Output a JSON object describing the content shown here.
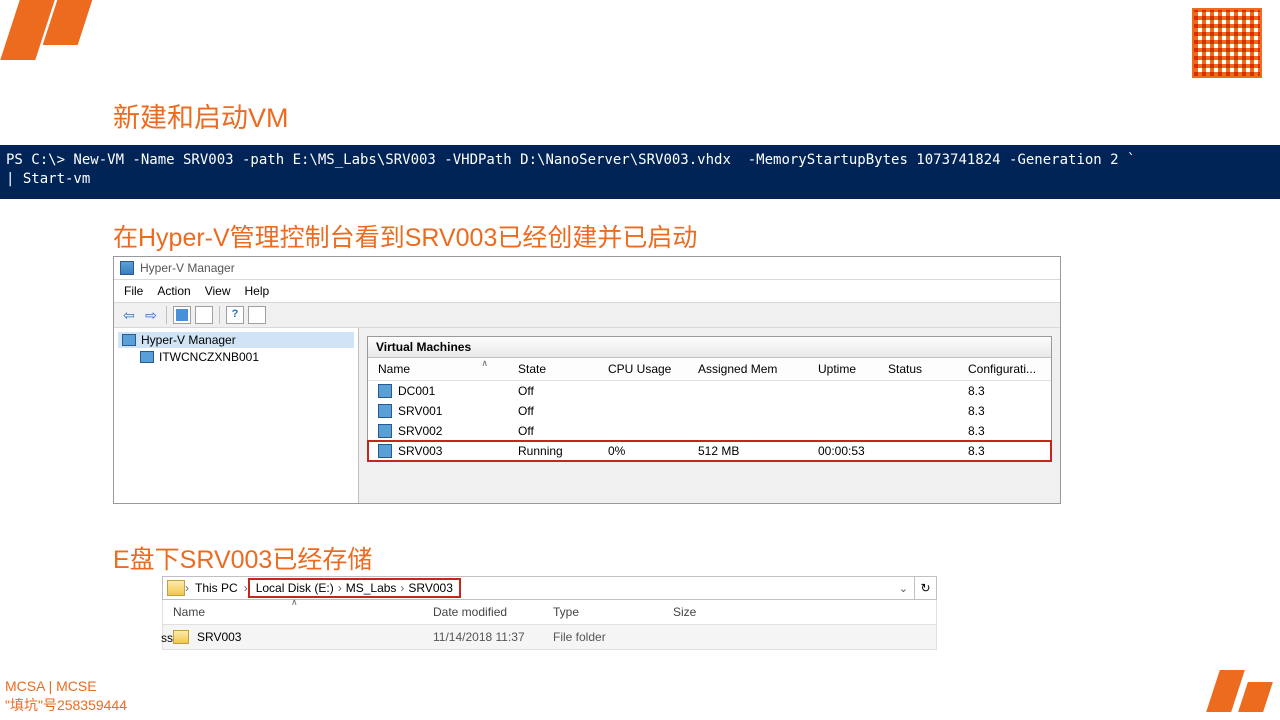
{
  "titles": {
    "main": "新建和启动VM",
    "second": "在Hyper-V管理控制台看到SRV003已经创建并已启动",
    "third": "E盘下SRV003已经存储"
  },
  "powershell": {
    "line1": "PS C:\\> New-VM -Name SRV003 -path E:\\MS_Labs\\SRV003 -VHDPath D:\\NanoServer\\SRV003.vhdx  -MemoryStartupBytes 1073741824 -Generation 2 `",
    "line2": "| Start-vm"
  },
  "hyperv": {
    "app_title": "Hyper-V Manager",
    "menu": {
      "file": "File",
      "action": "Action",
      "view": "View",
      "help": "Help"
    },
    "tree": {
      "root": "Hyper-V Manager",
      "host": "ITWCNCZXNB001"
    },
    "panel_title": "Virtual Machines",
    "columns": {
      "name": "Name",
      "state": "State",
      "cpu": "CPU Usage",
      "mem": "Assigned Mem",
      "uptime": "Uptime",
      "status": "Status",
      "config": "Configurati..."
    },
    "rows": [
      {
        "name": "DC001",
        "state": "Off",
        "cpu": "",
        "mem": "",
        "uptime": "",
        "status": "",
        "config": "8.3",
        "hl": false
      },
      {
        "name": "SRV001",
        "state": "Off",
        "cpu": "",
        "mem": "",
        "uptime": "",
        "status": "",
        "config": "8.3",
        "hl": false
      },
      {
        "name": "SRV002",
        "state": "Off",
        "cpu": "",
        "mem": "",
        "uptime": "",
        "status": "",
        "config": "8.3",
        "hl": false
      },
      {
        "name": "SRV003",
        "state": "Running",
        "cpu": "0%",
        "mem": "512 MB",
        "uptime": "00:00:53",
        "status": "",
        "config": "8.3",
        "hl": true
      }
    ]
  },
  "explorer": {
    "breadcrumb": {
      "root": "This PC",
      "disk": "Local Disk (E:)",
      "folder1": "MS_Labs",
      "folder2": "SRV003"
    },
    "side": "ss",
    "columns": {
      "name": "Name",
      "date": "Date modified",
      "type": "Type",
      "size": "Size"
    },
    "row": {
      "name": "SRV003",
      "date": "11/14/2018 11:37",
      "type": "File folder",
      "size": ""
    }
  },
  "footer": {
    "line1": "MCSA | MCSE",
    "line2": "\"填坑\"号258359444"
  }
}
